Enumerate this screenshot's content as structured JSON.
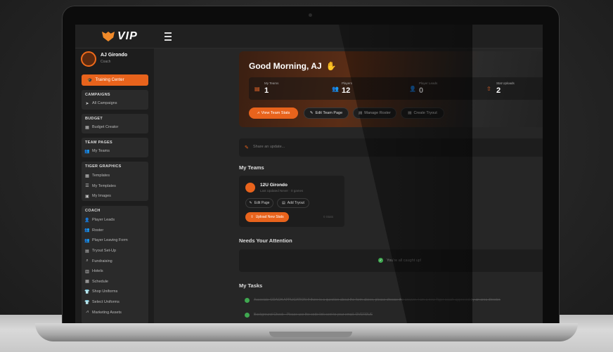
{
  "app": {
    "logo_text": "VIP",
    "brand_color": "#e8631c"
  },
  "profile": {
    "name": "AJ Girondo",
    "role": "Coach"
  },
  "sidebar": {
    "training_label": "Training Center",
    "groups": [
      {
        "title": "CAMPAIGNS",
        "items": [
          {
            "icon": "paper-plane-icon",
            "label": "All Campaigns"
          }
        ]
      },
      {
        "title": "BUDGET",
        "items": [
          {
            "icon": "calculator-icon",
            "label": "Budget Creator"
          }
        ]
      },
      {
        "title": "TEAM PAGES",
        "items": [
          {
            "icon": "users-icon",
            "label": "My Teams"
          }
        ]
      },
      {
        "title": "TIGER GRAPHICS",
        "items": [
          {
            "icon": "grid-icon",
            "label": "Templates"
          },
          {
            "icon": "list-icon",
            "label": "My Templates"
          },
          {
            "icon": "image-icon",
            "label": "My Images"
          }
        ]
      },
      {
        "title": "COACH",
        "items": [
          {
            "icon": "user-plus-icon",
            "label": "Player Leads"
          },
          {
            "icon": "users-icon",
            "label": "Roster"
          },
          {
            "icon": "users-icon",
            "label": "Player Leaving Form"
          },
          {
            "icon": "clipboard-icon",
            "label": "Tryout Set-Up"
          },
          {
            "icon": "search-icon",
            "label": "Fundraising"
          },
          {
            "icon": "building-icon",
            "label": "Hotels"
          },
          {
            "icon": "calendar-icon",
            "label": "Schedule"
          },
          {
            "icon": "shirt-icon",
            "label": "Shop Uniforms"
          },
          {
            "icon": "shirt-icon",
            "label": "Select Uniforms"
          },
          {
            "icon": "chart-icon",
            "label": "Marketing Assets"
          }
        ]
      }
    ]
  },
  "hero": {
    "greeting": "Good Morning, AJ",
    "stats": [
      {
        "icon": "chart-icon",
        "label": "My Teams",
        "value": "1"
      },
      {
        "icon": "users-icon",
        "label": "Players",
        "value": "12"
      },
      {
        "icon": "user-plus-icon",
        "label": "Player Leads",
        "value": "0"
      },
      {
        "icon": "upload-icon",
        "label": "Stat Uploads",
        "value": "2"
      }
    ],
    "buttons": [
      {
        "icon": "chart-icon",
        "label": "View Team Stats"
      },
      {
        "icon": "edit-icon",
        "label": "Edit Team Page"
      },
      {
        "icon": "clipboard-icon",
        "label": "Manage Roster"
      },
      {
        "icon": "clipboard-icon",
        "label": "Create Tryout"
      }
    ]
  },
  "update": {
    "placeholder": "Share an update..."
  },
  "my_teams": {
    "title": "My Teams",
    "team": {
      "name": "12U Girondo",
      "meta": "Last Updated Never  ·  0 games",
      "edit_label": "Edit Page",
      "tryout_label": "Add Tryout",
      "upload_label": "Upload New Stats",
      "footer": "0 Stats"
    }
  },
  "attention": {
    "title": "Needs Your Attention",
    "empty": "You're all caught up!"
  },
  "tasks": {
    "title": "My Tasks",
    "items": [
      {
        "text": "Associate COACH APPLICATION If there is a question about the form above, please choose the answer. I am a new Tiger coach approved by an area director.",
        "highlight": "COACH APPLICATION"
      },
      {
        "text": "Background Check - Please use the code link sent to your email. OVERDUE"
      }
    ]
  }
}
